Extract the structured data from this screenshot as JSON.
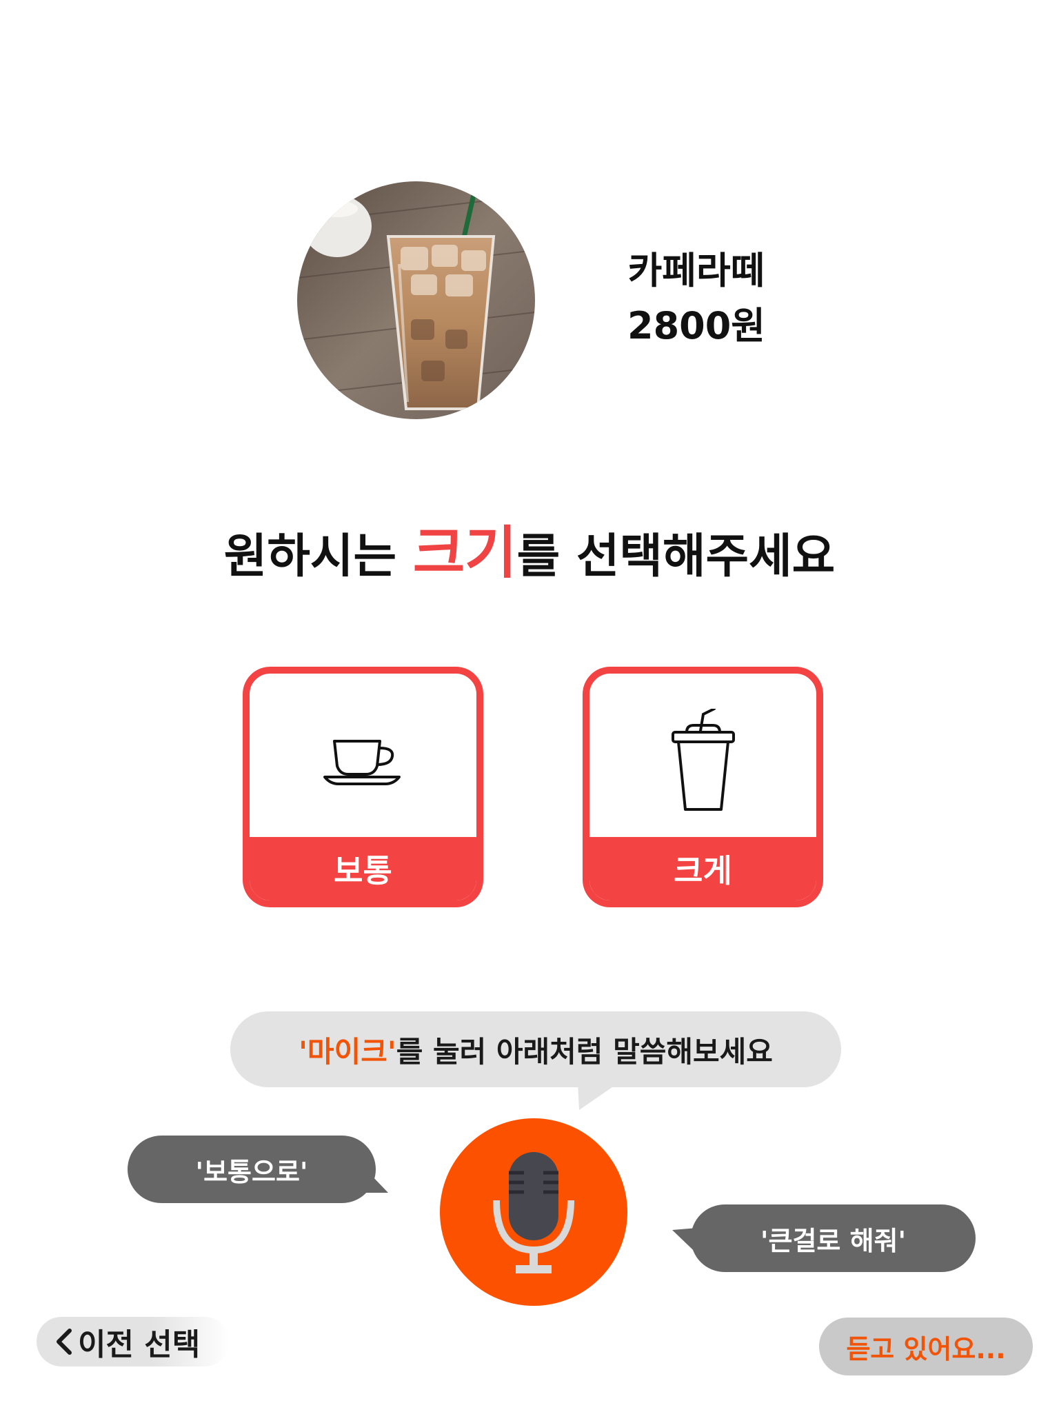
{
  "product": {
    "name": "카페라떼",
    "price": "2800원",
    "photo": "iced-latte-photo"
  },
  "prompt": {
    "before": "원하시는 ",
    "accent": "크기",
    "after": "를 선택해주세요"
  },
  "sizes": [
    {
      "label": "보통",
      "icon": "coffee-cup-icon"
    },
    {
      "label": "크게",
      "icon": "takeout-cup-icon"
    }
  ],
  "instruction": {
    "accent": "'마이크'",
    "rest": "를 눌러 아래처럼 말씀해보세요"
  },
  "examples": {
    "left": "'보통으로'",
    "right": "'큰걸로 해줘'"
  },
  "mic": {
    "icon": "microphone-icon"
  },
  "back": {
    "label": "이전 선택",
    "icon": "chevron-left-icon"
  },
  "status": {
    "label": "듣고 있어요..."
  },
  "colors": {
    "accent_red": "#f34343",
    "mic_orange": "#fc5200",
    "bubble_dark": "#666666",
    "bubble_light": "#e3e3e3"
  }
}
